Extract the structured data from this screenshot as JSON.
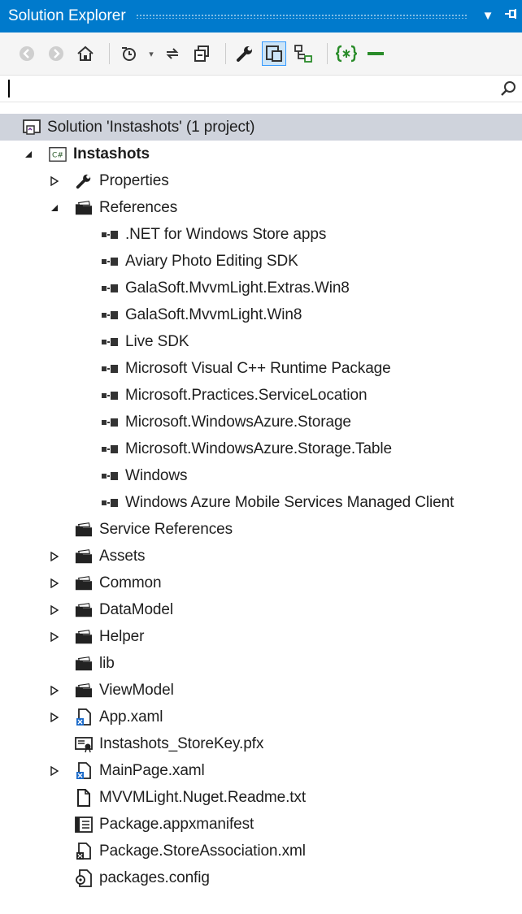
{
  "window": {
    "title": "Solution Explorer",
    "dropdown_glyph": "▼",
    "pin_glyph": "⊣"
  },
  "toolbar": {
    "buttons": [
      {
        "name": "back-icon"
      },
      {
        "name": "forward-icon"
      },
      {
        "name": "home-icon"
      },
      {
        "name": "pending-changes-icon"
      },
      {
        "name": "sync-icon"
      },
      {
        "name": "collapse-all-icon"
      },
      {
        "name": "properties-wrench-icon"
      },
      {
        "name": "preview-selected-icon"
      },
      {
        "name": "class-view-icon"
      },
      {
        "name": "xaml-icon"
      },
      {
        "name": "minus-icon"
      }
    ]
  },
  "search": {
    "value": "",
    "placeholder": ""
  },
  "tree": {
    "solution": "Solution 'Instashots' (1 project)",
    "project": "Instashots",
    "properties": "Properties",
    "references": "References",
    "reference_items": [
      ".NET for Windows Store apps",
      "Aviary Photo Editing SDK",
      "GalaSoft.MvvmLight.Extras.Win8",
      "GalaSoft.MvvmLight.Win8",
      "Live SDK",
      "Microsoft Visual C++ Runtime Package",
      "Microsoft.Practices.ServiceLocation",
      "Microsoft.WindowsAzure.Storage",
      "Microsoft.WindowsAzure.Storage.Table",
      "Windows",
      "Windows Azure Mobile Services Managed Client"
    ],
    "folders": {
      "service_references": "Service References",
      "assets": "Assets",
      "common": "Common",
      "datamodel": "DataModel",
      "helper": "Helper",
      "lib": "lib",
      "viewmodel": "ViewModel"
    },
    "files": {
      "app_xaml": "App.xaml",
      "storekey": "Instashots_StoreKey.pfx",
      "mainpage": "MainPage.xaml",
      "readme": "MVVMLight.Nuget.Readme.txt",
      "manifest": "Package.appxmanifest",
      "storeassoc": "Package.StoreAssociation.xml",
      "packages": "packages.config"
    },
    "project_badge": "C#"
  },
  "colors": {
    "titlebar": "#007acc",
    "selected_row": "#cfd3dc",
    "toolbar_bg": "#f5f5f5",
    "accent_green": "#2a8c2a"
  }
}
